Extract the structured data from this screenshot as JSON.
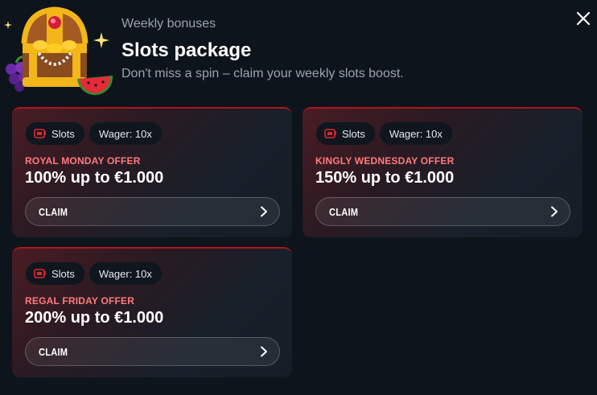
{
  "header": {
    "eyebrow": "Weekly bonuses",
    "title": "Slots package",
    "subtitle": "Don't miss a spin – claim your weekly slots boost."
  },
  "colors": {
    "accent_red": "#b0141e",
    "offer_label": "#ff7a80",
    "background": "#0d141c"
  },
  "icons": {
    "close": "close-icon",
    "tag": "slot-machine-icon",
    "claim": "chevron-right-icon",
    "hero": "treasure-chest-illustration"
  },
  "offers": [
    {
      "category_tag": "Slots",
      "wager_tag": "Wager: 10x",
      "label": "ROYAL MONDAY OFFER",
      "value": "100% up to €1.000",
      "button": "CLAIM"
    },
    {
      "category_tag": "Slots",
      "wager_tag": "Wager: 10x",
      "label": "KINGLY WEDNESDAY OFFER",
      "value": "150% up to €1.000",
      "button": "CLAIM"
    },
    {
      "category_tag": "Slots",
      "wager_tag": "Wager: 10x",
      "label": "REGAL FRIDAY OFFER",
      "value": "200% up to €1.000",
      "button": "CLAIM"
    }
  ]
}
